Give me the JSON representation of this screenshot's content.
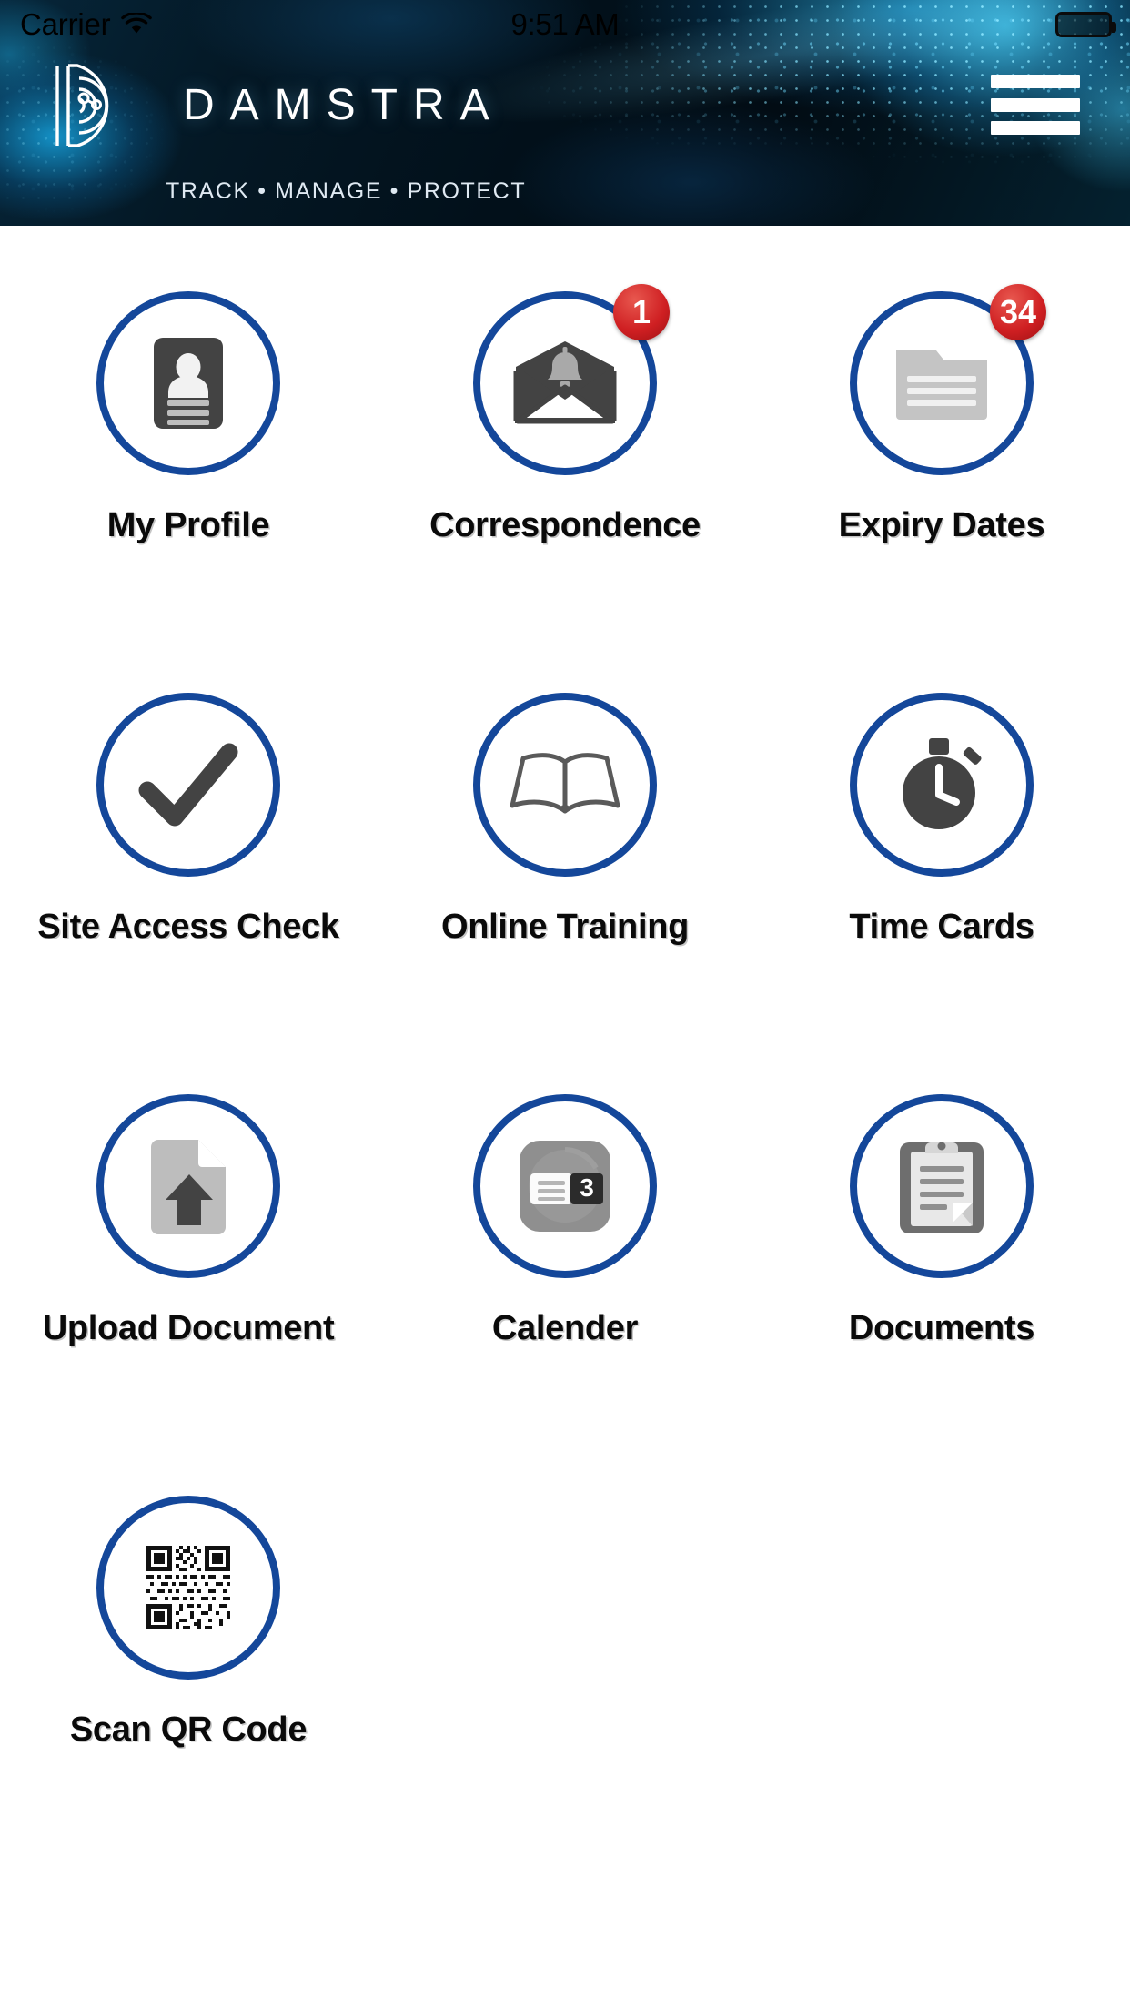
{
  "status_bar": {
    "carrier": "Carrier",
    "wifi_icon": "wifi-icon",
    "time": "9:51 AM",
    "battery_icon": "battery-icon"
  },
  "header": {
    "logo_icon": "damstra-d-logo-icon",
    "brand_name": "DAMSTRA",
    "tagline_parts": [
      "TRACK",
      "MANAGE",
      "PROTECT"
    ],
    "tagline_separator": "•",
    "tagline_full": "TRACK • MANAGE • PROTECT",
    "menu_icon": "hamburger-menu-icon",
    "background_color": "#02101a",
    "accent_color": "#1e9ad2"
  },
  "theme": {
    "ring_color": "#14479a",
    "badge_color": "#cf1f22",
    "icon_dark": "#434343",
    "icon_light": "#bdbdbd",
    "label_color": "#0a0a0a",
    "page_background": "#ffffff"
  },
  "menu": {
    "tiles": [
      {
        "label": "My Profile",
        "icon": "id-card-icon",
        "badge": null
      },
      {
        "label": "Correspondence",
        "icon": "envelope-bell-icon",
        "badge": "1"
      },
      {
        "label": "Expiry Dates",
        "icon": "documents-stack-icon",
        "badge": "34"
      },
      {
        "label": "Site Access Check",
        "icon": "checkmark-icon",
        "badge": null
      },
      {
        "label": "Online Training",
        "icon": "open-book-icon",
        "badge": null
      },
      {
        "label": "Time Cards",
        "icon": "stopwatch-icon",
        "badge": null
      },
      {
        "label": "Upload Document",
        "icon": "document-upload-icon",
        "badge": null
      },
      {
        "label": "Calender",
        "icon": "calendar-icon",
        "badge": null
      },
      {
        "label": "Documents",
        "icon": "clipboard-icon",
        "badge": null
      },
      {
        "label": "Scan QR Code",
        "icon": "qr-code-icon",
        "badge": null
      }
    ]
  },
  "calendar_icon_day": "3"
}
